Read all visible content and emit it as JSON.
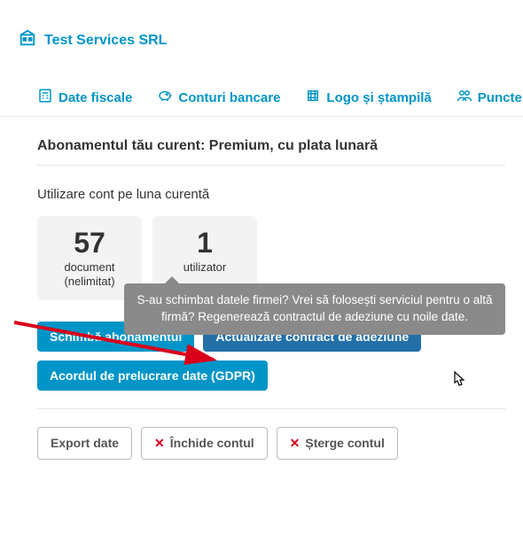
{
  "company": {
    "name": "Test Services SRL"
  },
  "tabs": {
    "fiscal": "Date fiscale",
    "bank": "Conturi bancare",
    "logo": "Logo și ștampilă",
    "points": "Puncte d"
  },
  "subscription": {
    "heading": "Abonamentul tău curent: Premium, cu plata lunară",
    "usage_title": "Utilizare cont pe luna curentă"
  },
  "stats": {
    "documents": {
      "value": "57",
      "label": "document",
      "sub": "(nelimitat)"
    },
    "users": {
      "value": "1",
      "label": "utilizator",
      "sub": ""
    }
  },
  "buttons": {
    "change_sub": "Schimbă abonamentul",
    "update_contract": "Actualizare contract de adeziune",
    "gdpr": "Acordul de prelucrare date (GDPR)",
    "export": "Export date",
    "close_account": "Închide contul",
    "delete_account": "Șterge contul"
  },
  "tooltip": {
    "text": "S-au schimbat datele firmei? Vrei să folosești serviciul pentru o altă firmă? Regenerează contractul de adeziune cu noile date."
  },
  "colors": {
    "primary": "#0095c8",
    "dark": "#2370a8",
    "danger": "#d9001b",
    "tooltip": "#8a8a8a"
  }
}
